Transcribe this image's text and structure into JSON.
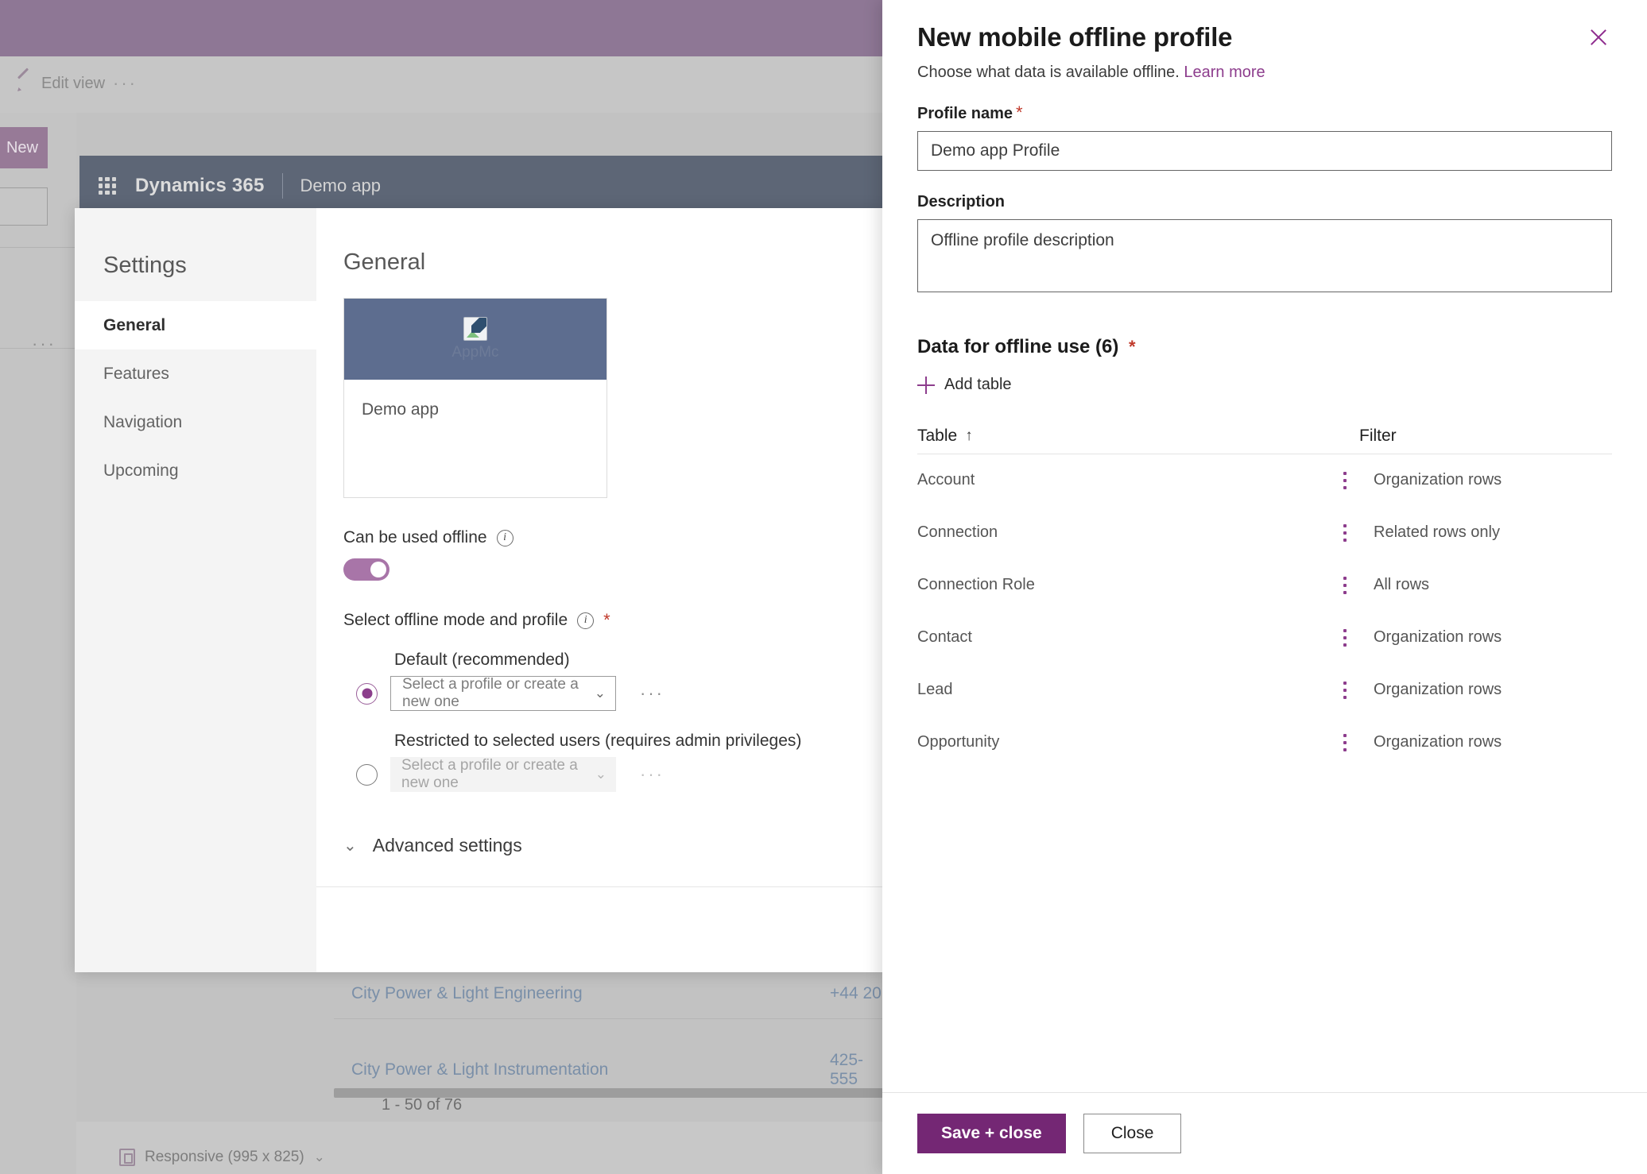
{
  "background": {
    "command_bar": {
      "edit_view_label": "Edit view",
      "overflow_label": "···"
    },
    "new_button_label": "New",
    "left_overflow_label": "···",
    "app_header": {
      "product_label": "Dynamics 365",
      "app_label": "Demo app"
    },
    "grid_rows": [
      {
        "name": "City Power & Light Engineering",
        "phone": "+44 20"
      },
      {
        "name": "City Power & Light Instrumentation",
        "phone": "425-555"
      }
    ],
    "record_count": "1 - 50 of 76",
    "status_bar": {
      "device_label": "Responsive (995 x 825)",
      "chevron": "⌄"
    }
  },
  "settings_dialog": {
    "title": "Settings",
    "nav_items": [
      {
        "label": "General",
        "active": true
      },
      {
        "label": "Features",
        "active": false
      },
      {
        "label": "Navigation",
        "active": false
      },
      {
        "label": "Upcoming",
        "active": false
      }
    ],
    "main_heading": "General",
    "app_card": {
      "broken_image_alt": "AppMc",
      "app_name": "Demo app"
    },
    "offline_toggle": {
      "label": "Can be used offline",
      "state": "on"
    },
    "offline_mode": {
      "label": "Select offline mode and profile",
      "required_marker": "*",
      "options": [
        {
          "label": "Default (recommended)",
          "placeholder": "Select a profile or create a new one",
          "selected": true,
          "disabled": false
        },
        {
          "label": "Restricted to selected users (requires admin privileges)",
          "placeholder": "Select a profile or create a new one",
          "selected": false,
          "disabled": true
        }
      ],
      "overflow_label": "···",
      "chevron": "⌄"
    },
    "advanced_settings": {
      "label": "Advanced settings",
      "chevron": "⌄"
    }
  },
  "side_panel": {
    "title": "New mobile offline profile",
    "subtitle": "Choose what data is available offline.",
    "learn_more": "Learn more",
    "profile_name": {
      "label": "Profile name",
      "required_marker": "*",
      "value": "Demo app Profile"
    },
    "description": {
      "label": "Description",
      "value": "Offline profile description"
    },
    "data_section": {
      "title": "Data for offline use (6)",
      "required_marker": "*",
      "add_table_label": "Add table",
      "columns": {
        "table": "Table",
        "sort_arrow": "↑",
        "filter": "Filter"
      },
      "rows": [
        {
          "table": "Account",
          "filter": "Organization rows"
        },
        {
          "table": "Connection",
          "filter": "Related rows only"
        },
        {
          "table": "Connection Role",
          "filter": "All rows"
        },
        {
          "table": "Contact",
          "filter": "Organization rows"
        },
        {
          "table": "Lead",
          "filter": "Organization rows"
        },
        {
          "table": "Opportunity",
          "filter": "Organization rows"
        }
      ]
    },
    "footer": {
      "save_label": "Save + close",
      "close_label": "Close"
    }
  },
  "colors": {
    "brand_purple": "#742774",
    "link_purple": "#8d3d8d",
    "required_red": "#c0392b",
    "app_thumb_blue": "#5d6d8f",
    "header_purple_dimmed": "#8e7795",
    "d365_bar": "#5d6676"
  }
}
